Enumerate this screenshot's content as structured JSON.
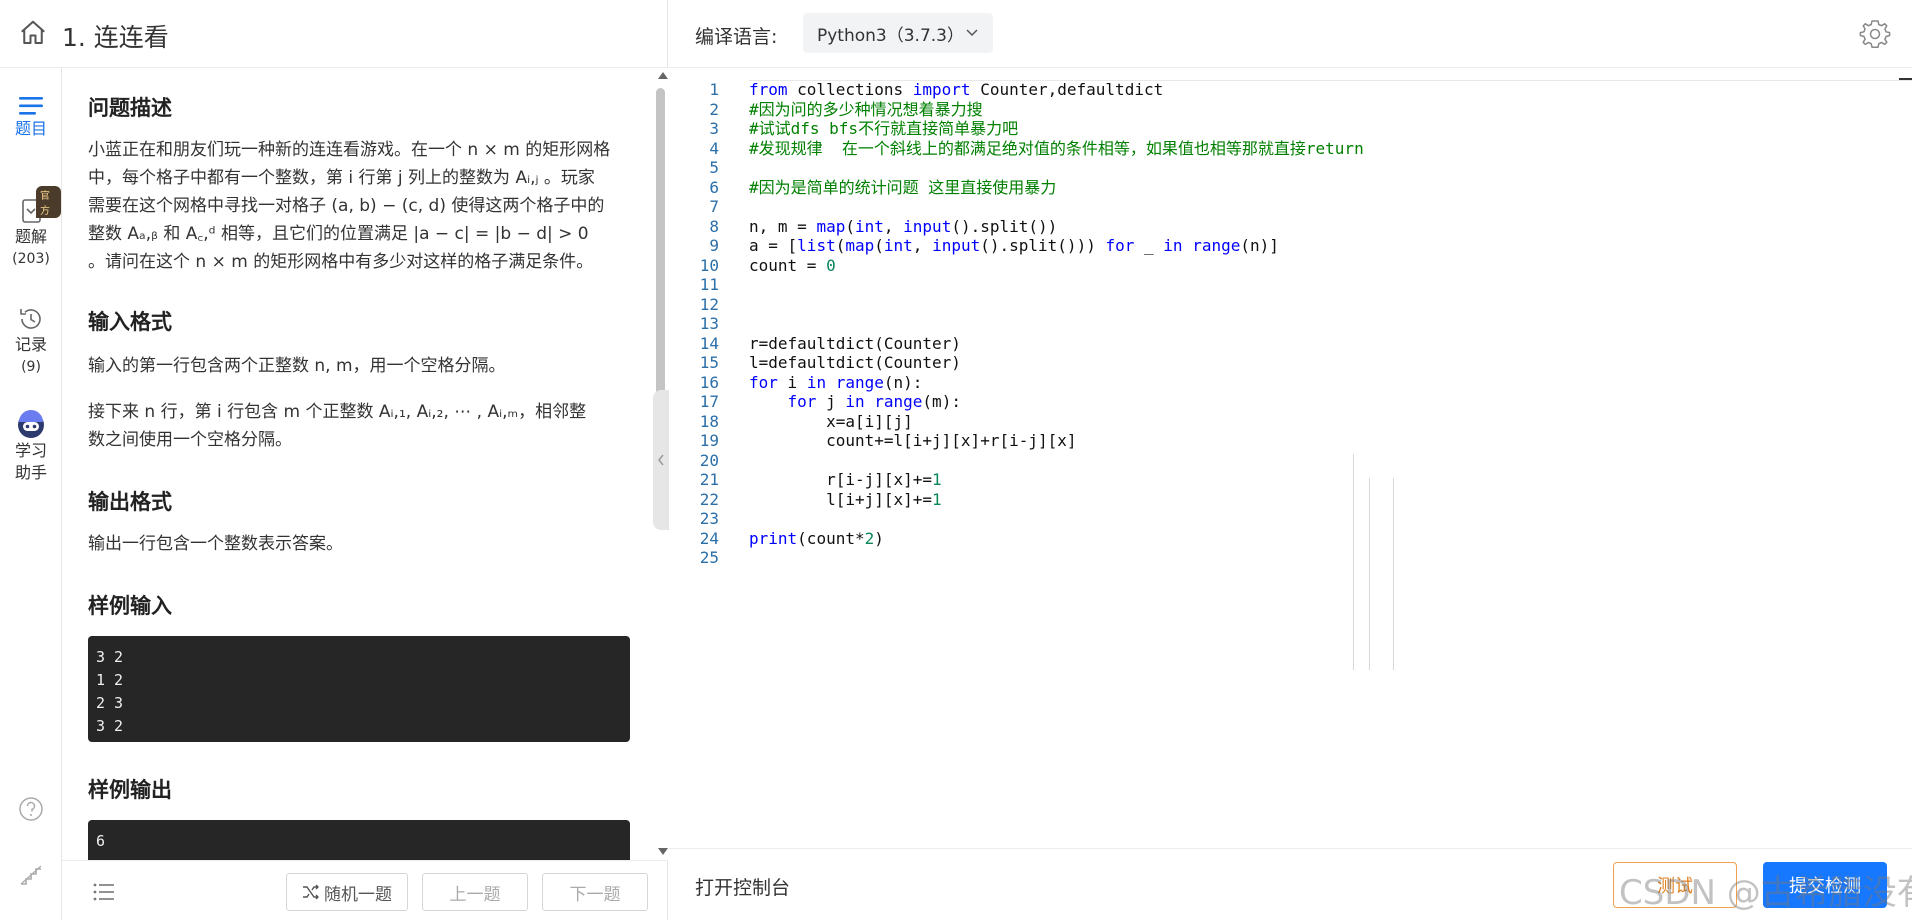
{
  "header": {
    "title": "1. 连连看"
  },
  "sidebar": {
    "items": [
      {
        "label": "题目"
      },
      {
        "label": "题解",
        "count": "(203)"
      },
      {
        "label": "记录",
        "count": "(9)"
      },
      {
        "label": "学习",
        "label2": "助手"
      }
    ],
    "badge": "官方"
  },
  "problem": {
    "sections": [
      {
        "heading": "问题描述"
      },
      {
        "heading": "输入格式"
      },
      {
        "heading": "输出格式"
      },
      {
        "heading": "样例输入"
      },
      {
        "heading": "样例输出"
      }
    ],
    "desc_lines": [
      "小蓝正在和朋友们玩一种新的连连看游戏。在一个 n × m 的矩形网格",
      "中，每个格子中都有一个整数，第 i 行第 j 列上的整数为 Aᵢ,ⱼ 。玩家",
      "需要在这个网格中寻找一对格子 (a, b) − (c, d) 使得这两个格子中的",
      "整数 Aₐ,ᵦ 和 A꜀,ᵈ 相等，且它们的位置满足 |a − c| = |b − d| > 0",
      "。请问在这个 n × m 的矩形网格中有多少对这样的格子满足条件。"
    ],
    "input_lines": [
      "输入的第一行包含两个正整数 n, m，用一个空格分隔。"
    ],
    "input_lines2": [
      "接下来 n 行，第 i 行包含 m 个正整数 Aᵢ,₁, Aᵢ,₂, ⋯ , Aᵢ,ₘ，相邻整",
      "数之间使用一个空格分隔。"
    ],
    "output_lines": [
      "输出一行包含一个整数表示答案。"
    ],
    "sample_input": [
      "3 2",
      "1 2",
      "2 3",
      "3 2"
    ],
    "sample_output": [
      "6"
    ]
  },
  "left_footer": {
    "random": "随机一题",
    "prev": "上一题",
    "next": "下一题"
  },
  "editor_header": {
    "lang_label": "编译语言:",
    "lang_value": "Python3（3.7.3）"
  },
  "code_lines": [
    "from collections import Counter,defaultdict",
    "#因为问的多少种情况想着暴力搜",
    "#试试dfs bfs不行就直接简单暴力吧",
    "#发现规律  在一个斜线上的都满足绝对值的条件相等，如果值也相等那就直接return",
    "",
    "#因为是简单的统计问题 这里直接使用暴力",
    "",
    "n, m = map(int, input().split())",
    "a = [list(map(int, input().split())) for _ in range(n)]",
    "count = 0",
    "",
    "",
    "",
    "r=defaultdict(Counter)",
    "l=defaultdict(Counter)",
    "for i in range(n):",
    "    for j in range(m):",
    "        x=a[i][j]",
    "        count+=l[i+j][x]+r[i-j][x]",
    "",
    "        r[i-j][x]+=1",
    "        l[i+j][x]+=1",
    "",
    "print(count*2)",
    ""
  ],
  "right_footer": {
    "console": "打开控制台",
    "test": "测试",
    "submit": "提交检测",
    "watermark": "CSDN @古希腊没有书"
  }
}
